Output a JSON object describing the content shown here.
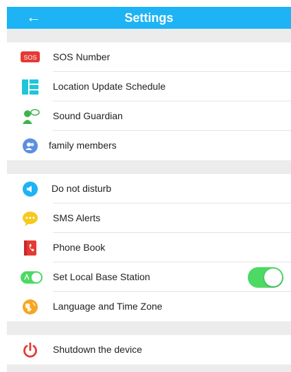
{
  "header": {
    "back_icon": "←",
    "title": "Settings",
    "color": "#1db3f5"
  },
  "section1": [
    {
      "label": "SOS Number",
      "icon": "sos-badge-icon"
    },
    {
      "label": "Location Update Schedule",
      "icon": "schedule-grid-icon"
    },
    {
      "label": "Sound Guardian",
      "icon": "person-speech-icon"
    },
    {
      "label": "family members",
      "icon": "family-members-icon"
    }
  ],
  "section2": [
    {
      "label": "Do not disturb",
      "icon": "mute-speaker-icon"
    },
    {
      "label": "SMS Alerts",
      "icon": "chat-bubble-icon"
    },
    {
      "label": "Phone Book",
      "icon": "phone-book-icon"
    },
    {
      "label": "Set Local Base Station",
      "icon": "toggle-icon",
      "toggle_on": true
    },
    {
      "label": "Language and Time Zone",
      "icon": "globe-icon"
    }
  ],
  "section3": [
    {
      "label": "Shutdown the device",
      "icon": "power-icon"
    }
  ],
  "icons": {
    "sos_text": "SOS"
  },
  "colors": {
    "accent": "#1db3f5",
    "toggle_on": "#4cd964",
    "sos_red": "#e53935",
    "power_red": "#e53935"
  }
}
